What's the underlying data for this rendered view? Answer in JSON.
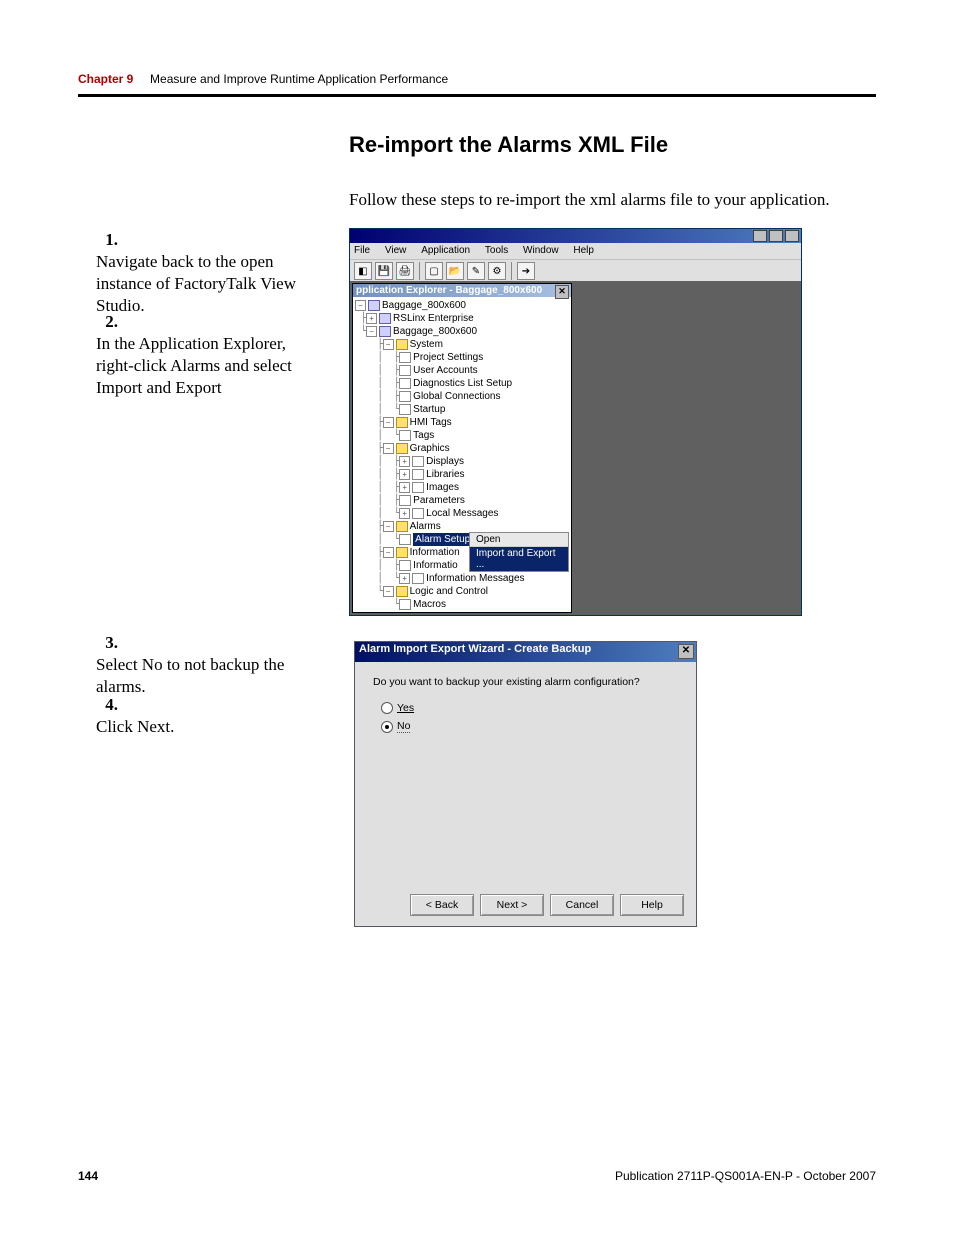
{
  "header": {
    "chapter": "Chapter 9",
    "title": "Measure and Improve Runtime Application Performance"
  },
  "section_title": "Re-import the Alarms XML File",
  "intro": "Follow these steps to re-import the xml alarms file to your application.",
  "steps": {
    "s1": {
      "num": "1.",
      "text": "Navigate back to the open instance of FactoryTalk View Studio."
    },
    "s2": {
      "num": "2.",
      "text": "In the Application Explorer, right-click Alarms and select Import and Export"
    },
    "s3": {
      "num": "3.",
      "text": "Select No to not backup the alarms."
    },
    "s4": {
      "num": "4.",
      "text": "Click Next."
    }
  },
  "shot1": {
    "menu": {
      "file": "File",
      "view": "View",
      "application": "Application",
      "tools": "Tools",
      "window": "Window",
      "help": "Help"
    },
    "explorer_title": "pplication Explorer - Baggage_800x600",
    "tree": {
      "root": "Baggage_800x600",
      "rslinx": "RSLinx Enterprise",
      "app": "Baggage_800x600",
      "system": "System",
      "project_settings": "Project Settings",
      "user_accounts": "User Accounts",
      "diag": "Diagnostics List Setup",
      "global_conn": "Global Connections",
      "startup": "Startup",
      "hmitags": "HMI Tags",
      "tags": "Tags",
      "graphics": "Graphics",
      "displays": "Displays",
      "libraries": "Libraries",
      "images": "Images",
      "parameters": "Parameters",
      "local_msgs": "Local Messages",
      "alarms": "Alarms",
      "alarm_setup": "Alarm Setup",
      "information": "Information",
      "informatio": "Informatio",
      "info_msgs": "Information Messages",
      "logic": "Logic and Control",
      "macros": "Macros"
    },
    "ctx": {
      "open": "Open",
      "import_export": "Import and Export ..."
    }
  },
  "shot2": {
    "title": "Alarm Import Export Wizard - Create Backup",
    "prompt": "Do you want to backup your existing alarm configuration?",
    "yes": "Yes",
    "no": "No",
    "back": "< Back",
    "next": "Next >",
    "cancel": "Cancel",
    "help": "Help"
  },
  "footer": {
    "page": "144",
    "pub": "Publication 2711P-QS001A-EN-P - October 2007"
  }
}
